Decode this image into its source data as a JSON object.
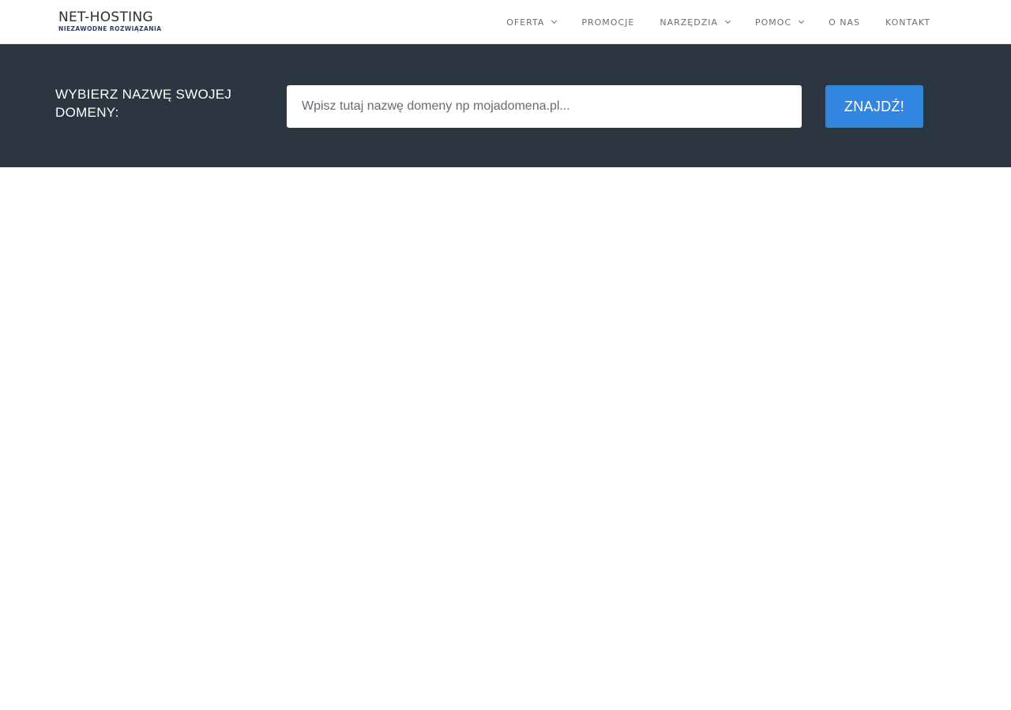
{
  "header": {
    "logo": {
      "title": "NET-HOSTING",
      "subtitle": "NIEZAWODNE ROZWIĄZANIA"
    },
    "nav": [
      {
        "label": "OFERTA",
        "dropdown": true
      },
      {
        "label": "PROMOCJE",
        "dropdown": false
      },
      {
        "label": "NARZĘDZIA",
        "dropdown": true
      },
      {
        "label": "POMOC",
        "dropdown": true
      },
      {
        "label": "O NAS",
        "dropdown": false
      },
      {
        "label": "KONTAKT",
        "dropdown": false
      }
    ]
  },
  "domain_search": {
    "label": "WYBIERZ NAZWĘ SWOJEJ DOMENY:",
    "input_value": "",
    "placeholder": "Wpisz tutaj nazwę domeny np mojadomena.pl...",
    "button_label": "ZNAJDŹ!"
  },
  "colors": {
    "domain_bar_bg": "#2b3640",
    "button_bg": "#3386e0",
    "nav_text": "#6b6f75"
  },
  "icons": [
    "chevron-down-icon"
  ]
}
